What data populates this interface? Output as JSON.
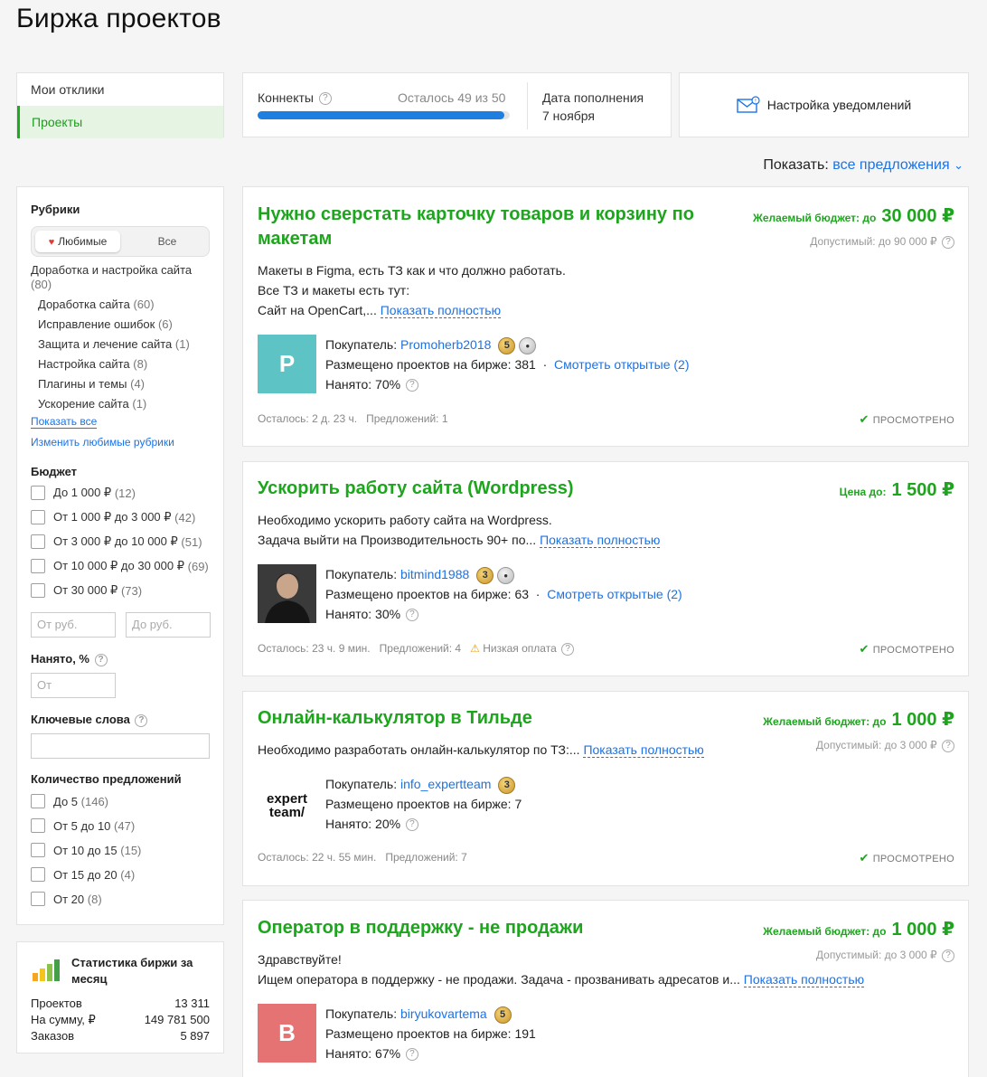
{
  "page": {
    "title": "Биржа проектов"
  },
  "tabs": [
    {
      "label": "Мои отклики",
      "active": false
    },
    {
      "label": "Проекты",
      "active": true
    }
  ],
  "connects": {
    "label": "Коннекты",
    "remaining_text": "Осталось  49 из 50",
    "remaining": 49,
    "total": 50,
    "refill_label": "Дата пополнения",
    "refill_date": "7 ноября"
  },
  "notifications": {
    "label": "Настройка уведомлений",
    "icon": "envelope-icon"
  },
  "show": {
    "label": "Показать:",
    "value": "все предложения"
  },
  "filters": {
    "rubrics_title": "Рубрики",
    "seg_favorites": "Любимые",
    "seg_all": "Все",
    "parent_category": {
      "label": "Доработка и настройка сайта",
      "count": "(80)"
    },
    "categories": [
      {
        "label": "Доработка сайта",
        "count": "(60)"
      },
      {
        "label": "Исправление ошибок",
        "count": "(6)"
      },
      {
        "label": "Защита и лечение сайта",
        "count": "(1)"
      },
      {
        "label": "Настройка сайта",
        "count": "(8)"
      },
      {
        "label": "Плагины и темы",
        "count": "(4)"
      },
      {
        "label": "Ускорение сайта",
        "count": "(1)"
      }
    ],
    "show_all": "Показать все",
    "edit_favorites": "Изменить любимые рубрики",
    "budget_title": "Бюджет",
    "budget_options": [
      {
        "label": "До 1 000 ₽",
        "count": "(12)"
      },
      {
        "label": "От 1 000 ₽ до 3 000 ₽",
        "count": "(42)"
      },
      {
        "label": "От 3 000 ₽ до 10 000 ₽",
        "count": "(51)"
      },
      {
        "label": "От 10 000 ₽ до 30 000 ₽",
        "count": "(69)"
      },
      {
        "label": "От 30 000 ₽",
        "count": "(73)"
      }
    ],
    "from_placeholder": "От руб.",
    "to_placeholder": "До руб.",
    "hired_title": "Нанято, %",
    "hired_placeholder": "От",
    "keywords_title": "Ключевые слова",
    "offers_title": "Количество предложений",
    "offers_options": [
      {
        "label": "До 5",
        "count": "(146)"
      },
      {
        "label": "От 5 до 10",
        "count": "(47)"
      },
      {
        "label": "От 10 до 15",
        "count": "(15)"
      },
      {
        "label": "От 15 до 20",
        "count": "(4)"
      },
      {
        "label": "От 20",
        "count": "(8)"
      }
    ]
  },
  "stats": {
    "title": "Статистика биржи за месяц",
    "rows": [
      {
        "label": "Проектов",
        "value": "13 311"
      },
      {
        "label": "На сумму,  ₽",
        "value": "149 781 500"
      },
      {
        "label": "Заказов",
        "value": "5 897"
      }
    ]
  },
  "colors": {
    "green": "#1ea51e",
    "link": "#1a73e8",
    "progress": "#1e7fe0"
  },
  "projects": [
    {
      "title_line1": "Нужно сверстать карточку товаров и корзину по",
      "title_line2": "макетам",
      "budget_label": "Желаемый бюджет: до",
      "budget": "30 000 ₽",
      "allowed": "Допустимый: до 90 000 ₽",
      "desc1": "Макеты в Figma, есть ТЗ как и что должно работать.",
      "desc2": "Все ТЗ и макеты есть тут:",
      "desc3": "Сайт на OpenCart,...",
      "more": "Показать полностью",
      "avatar_letter": "P",
      "avatar_color": "#5ec3c4",
      "buyer_label": "Покупатель:",
      "buyer": "Promoherb2018",
      "badge": "5",
      "posted_label": "Размещено проектов на бирже: 381",
      "open_link": "Смотреть открытые (2)",
      "hired": "Нанято: 70%",
      "time_left": "Осталось: 2 д. 23 ч.",
      "offers": "Предложений: 1",
      "viewed": "ПРОСМОТРЕНО"
    },
    {
      "title_line1": "Ускорить работу сайта (Wordpress)",
      "budget_label": "Цена до:",
      "budget": "1 500 ₽",
      "desc1": "Необходимо ускорить работу сайта на Wordpress.",
      "desc2": "Задача выйти на Производительность 90+ по...",
      "more": "Показать полностью",
      "buyer_label": "Покупатель:",
      "buyer": "bitmind1988",
      "badge": "3",
      "posted_label": "Размещено проектов на бирже: 63",
      "open_link": "Смотреть открытые (2)",
      "hired": "Нанято: 30%",
      "time_left": "Осталось: 23 ч. 9 мин.",
      "offers": "Предложений: 4",
      "low_pay": "Низкая оплата",
      "viewed": "ПРОСМОТРЕНО"
    },
    {
      "title_line1": "Онлайн-калькулятор в Тильде",
      "budget_label": "Желаемый бюджет: до",
      "budget": "1 000 ₽",
      "allowed": "Допустимый: до 3 000 ₽",
      "desc1": "Необходимо разработать онлайн-калькулятор по ТЗ:...",
      "more": "Показать полностью",
      "logo_line1": "expert",
      "logo_line2": "team/",
      "buyer_label": "Покупатель:",
      "buyer": "info_expertteam",
      "badge": "3",
      "posted_label": "Размещено проектов на бирже: 7",
      "hired": "Нанято: 20%",
      "time_left": "Осталось: 22 ч. 55 мин.",
      "offers": "Предложений: 7",
      "viewed": "ПРОСМОТРЕНО"
    },
    {
      "title_line1": "Оператор в поддержку - не продажи",
      "budget_label": "Желаемый бюджет: до",
      "budget": "1 000 ₽",
      "allowed": "Допустимый: до 3 000 ₽",
      "desc1": "Здравствуйте!",
      "desc2": "Ищем оператора в поддержку - не продажи. Задача - прозванивать адресатов и...",
      "more": "Показать полностью",
      "avatar_letter": "B",
      "avatar_color": "#e57373",
      "buyer_label": "Покупатель:",
      "buyer": "biryukovartema",
      "badge": "5",
      "posted_label": "Размещено проектов на бирже: 191",
      "hired": "Нанято: 67%"
    }
  ]
}
